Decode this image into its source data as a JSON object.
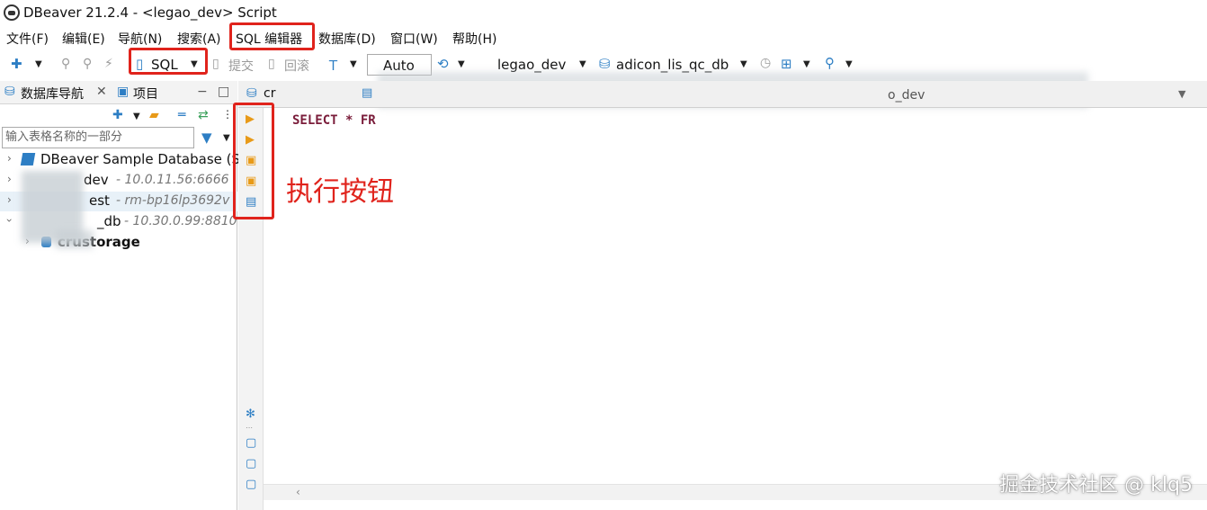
{
  "window": {
    "title": "DBeaver 21.2.4 - <legao_dev> Script"
  },
  "menu": [
    {
      "label": "文件(F)"
    },
    {
      "label": "编辑(E)"
    },
    {
      "label": "导航(N)"
    },
    {
      "label": "搜索(A)"
    },
    {
      "label": "SQL 编辑器"
    },
    {
      "label": "数据库(D)"
    },
    {
      "label": "窗口(W)"
    },
    {
      "label": "帮助(H)"
    }
  ],
  "toolbar": {
    "sql_label": "SQL",
    "commit_label": "提交",
    "rollback_label": "回滚",
    "transaction_mode": "Auto",
    "datasource": "legao_dev",
    "schema": "adicon_lis_qc_db"
  },
  "navigator": {
    "tab_label": "数据库导航",
    "projects_tab_label": "项目",
    "filter_placeholder": "输入表格名称的一部分",
    "items": [
      {
        "label": "DBeaver Sample Database (SQ",
        "address": ""
      },
      {
        "label": "dev",
        "address": "- 10.0.11.56:6666"
      },
      {
        "label": "est",
        "address": "- rm-bp16lp3692v"
      },
      {
        "label": "_db",
        "address": "- 10.30.0.99:8810"
      },
      {
        "label": "crustorage",
        "address": ""
      }
    ]
  },
  "editor": {
    "tab_label": "cr",
    "tab_label_right": "o_dev",
    "code": "SELECT * FR"
  },
  "annotation": "执行按钮",
  "watermark": "掘金技术社区 @ klq5",
  "colors": {
    "highlight": "#e0231c",
    "accent": "#2d7ec4",
    "run": "#e89a18"
  }
}
